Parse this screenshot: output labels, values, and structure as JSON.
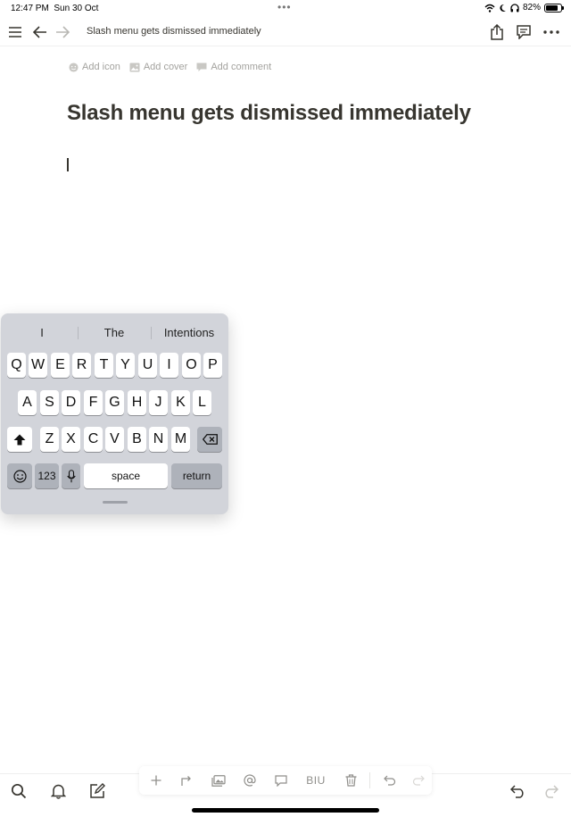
{
  "status_bar": {
    "time": "12:47 PM",
    "date": "Sun 30 Oct",
    "battery": "82%",
    "battery_level": 0.82
  },
  "nav": {
    "title": "Slash menu gets dismissed immediately"
  },
  "page": {
    "actions": {
      "add_icon": "Add icon",
      "add_cover": "Add cover",
      "add_comment": "Add comment"
    },
    "title": "Slash menu gets dismissed immediately"
  },
  "keyboard": {
    "suggestions": [
      "I",
      "The",
      "Intentions"
    ],
    "row1": [
      "Q",
      "W",
      "E",
      "R",
      "T",
      "Y",
      "U",
      "I",
      "O",
      "P"
    ],
    "row2": [
      "A",
      "S",
      "D",
      "F",
      "G",
      "H",
      "J",
      "K",
      "L"
    ],
    "row3": [
      "Z",
      "X",
      "C",
      "V",
      "B",
      "N",
      "M"
    ],
    "numbers_label": "123",
    "space_label": "space",
    "return_label": "return"
  },
  "toolbar": {
    "format_label": "BIU"
  },
  "icons": {
    "menu": "menu-icon",
    "back": "arrow-left-icon",
    "forward": "arrow-right-icon",
    "share": "share-icon",
    "comments": "comment-icon",
    "more": "more-icon",
    "search": "search-icon",
    "bell": "bell-icon",
    "compose": "compose-icon"
  }
}
